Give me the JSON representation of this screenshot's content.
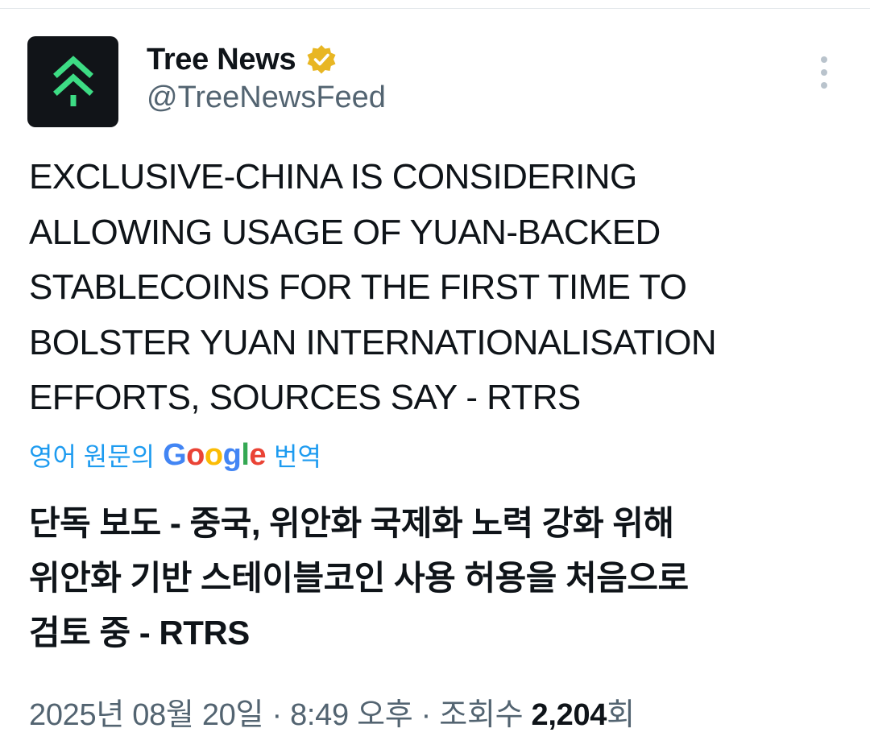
{
  "author": {
    "name": "Tree News",
    "handle": "@TreeNewsFeed",
    "verified_color": "#e8b623"
  },
  "tweet": {
    "lines": [
      "EXCLUSIVE-CHINA IS CONSIDERING",
      "ALLOWING USAGE OF YUAN-BACKED",
      "STABLECOINS FOR THE FIRST TIME TO",
      "BOLSTER YUAN INTERNATIONALISATION",
      "EFFORTS, SOURCES SAY - RTRS"
    ]
  },
  "translation": {
    "prefix": "영어 원문의",
    "google_letters": [
      "G",
      "o",
      "o",
      "g",
      "l",
      "e"
    ],
    "suffix": "번역",
    "lines": [
      "단독 보도 - 중국, 위안화 국제화 노력 강화 위해",
      "위안화 기반 스테이블코인 사용 허용을 처음으로",
      "검토 중 - RTRS"
    ]
  },
  "meta": {
    "date": "2025년 08월 20일",
    "time": "8:49 오후",
    "views_label": "조회수",
    "views_count": "2,204",
    "views_suffix": "회",
    "separator": "·"
  },
  "colors": {
    "accent": "#1d9bf0",
    "muted": "#536471",
    "avatar_bg": "#111418",
    "logo_green": "#3ddc84"
  },
  "icons": {
    "avatar": "tree-logo-icon",
    "verified": "verified-badge-icon",
    "more": "more-vertical-icon"
  }
}
